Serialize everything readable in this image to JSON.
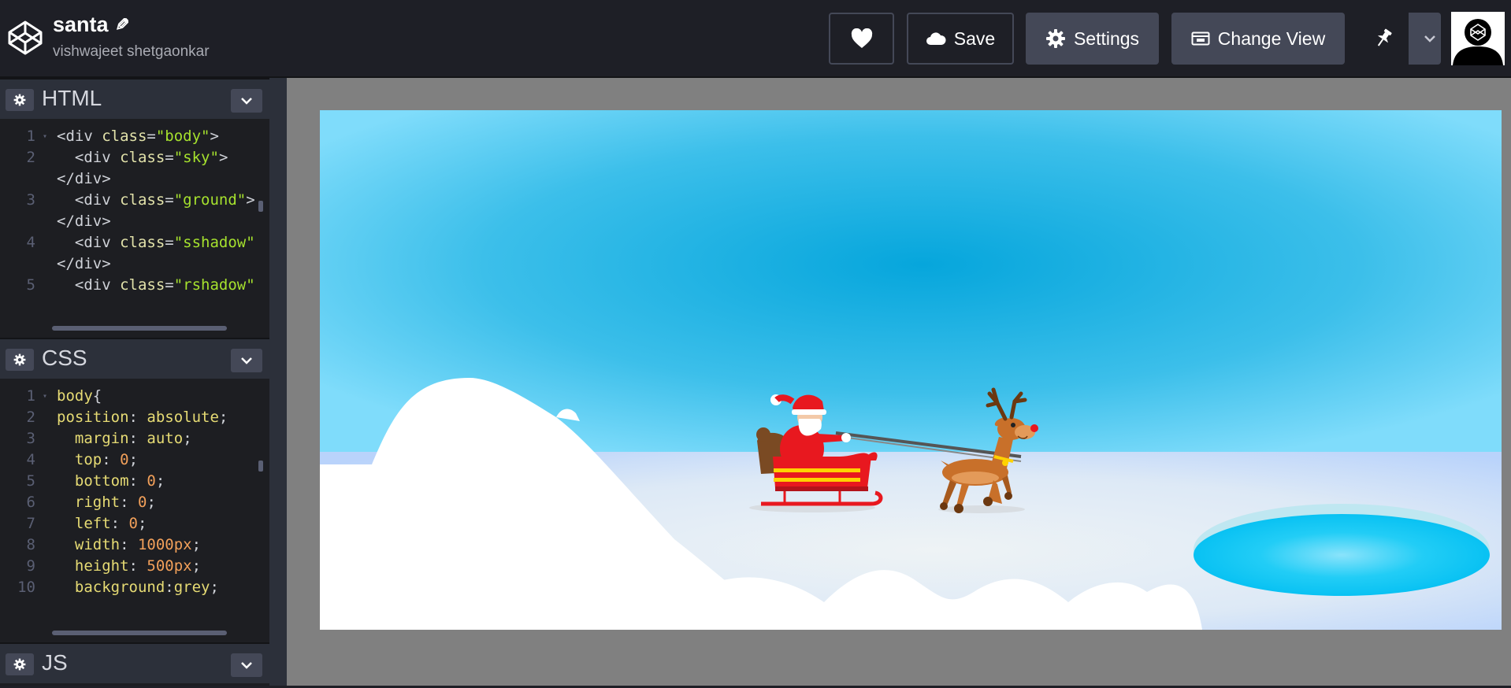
{
  "header": {
    "title": "santa",
    "author": "vishwajeet shetgaonkar",
    "buttons": {
      "save": "Save",
      "settings": "Settings",
      "change_view": "Change View"
    }
  },
  "editors": {
    "html": {
      "title": "HTML",
      "lines": [
        {
          "n": "1",
          "fold": true,
          "parts": [
            [
              "tag",
              "<div "
            ],
            [
              "attr",
              "class"
            ],
            [
              "tag",
              "="
            ],
            [
              "str",
              "\"body\""
            ],
            [
              "tag",
              ">"
            ]
          ]
        },
        {
          "n": "2",
          "parts": [
            [
              "tag",
              "  <div "
            ],
            [
              "attr",
              "class"
            ],
            [
              "tag",
              "="
            ],
            [
              "str",
              "\"sky\""
            ],
            [
              "tag",
              ">"
            ]
          ]
        },
        {
          "n": "",
          "parts": [
            [
              "tag",
              "</div>"
            ]
          ]
        },
        {
          "n": "3",
          "parts": [
            [
              "tag",
              "  <div "
            ],
            [
              "attr",
              "class"
            ],
            [
              "tag",
              "="
            ],
            [
              "str",
              "\"ground\""
            ],
            [
              "tag",
              ">"
            ]
          ]
        },
        {
          "n": "",
          "parts": [
            [
              "tag",
              "</div>"
            ]
          ]
        },
        {
          "n": "4",
          "parts": [
            [
              "tag",
              "  <div "
            ],
            [
              "attr",
              "class"
            ],
            [
              "tag",
              "="
            ],
            [
              "str",
              "\"sshadow\""
            ]
          ]
        },
        {
          "n": "",
          "parts": [
            [
              "tag",
              "</div>"
            ]
          ]
        },
        {
          "n": "5",
          "parts": [
            [
              "tag",
              "  <div "
            ],
            [
              "attr",
              "class"
            ],
            [
              "tag",
              "="
            ],
            [
              "str",
              "\"rshadow\""
            ]
          ]
        }
      ]
    },
    "css": {
      "title": "CSS",
      "lines": [
        {
          "n": "1",
          "fold": true,
          "parts": [
            [
              "sel",
              "body"
            ],
            [
              "tag",
              "{"
            ]
          ]
        },
        {
          "n": "2",
          "parts": [
            [
              "prop",
              "position"
            ],
            [
              "tag",
              ": "
            ],
            [
              "val",
              "absolute"
            ],
            [
              "tag",
              ";"
            ]
          ]
        },
        {
          "n": "3",
          "parts": [
            [
              "tag",
              "  "
            ],
            [
              "prop",
              "margin"
            ],
            [
              "tag",
              ": "
            ],
            [
              "val",
              "auto"
            ],
            [
              "tag",
              ";"
            ]
          ]
        },
        {
          "n": "4",
          "parts": [
            [
              "tag",
              "  "
            ],
            [
              "prop",
              "top"
            ],
            [
              "tag",
              ": "
            ],
            [
              "num",
              "0"
            ],
            [
              "tag",
              ";"
            ]
          ]
        },
        {
          "n": "5",
          "parts": [
            [
              "tag",
              "  "
            ],
            [
              "prop",
              "bottom"
            ],
            [
              "tag",
              ": "
            ],
            [
              "num",
              "0"
            ],
            [
              "tag",
              ";"
            ]
          ]
        },
        {
          "n": "6",
          "parts": [
            [
              "tag",
              "  "
            ],
            [
              "prop",
              "right"
            ],
            [
              "tag",
              ": "
            ],
            [
              "num",
              "0"
            ],
            [
              "tag",
              ";"
            ]
          ]
        },
        {
          "n": "7",
          "parts": [
            [
              "tag",
              "  "
            ],
            [
              "prop",
              "left"
            ],
            [
              "tag",
              ": "
            ],
            [
              "num",
              "0"
            ],
            [
              "tag",
              ";"
            ]
          ]
        },
        {
          "n": "8",
          "parts": [
            [
              "tag",
              "  "
            ],
            [
              "prop",
              "width"
            ],
            [
              "tag",
              ": "
            ],
            [
              "num",
              "1000px"
            ],
            [
              "tag",
              ";"
            ]
          ]
        },
        {
          "n": "9",
          "parts": [
            [
              "tag",
              "  "
            ],
            [
              "prop",
              "height"
            ],
            [
              "tag",
              ": "
            ],
            [
              "num",
              "500px"
            ],
            [
              "tag",
              ";"
            ]
          ]
        },
        {
          "n": "10",
          "parts": [
            [
              "tag",
              "  "
            ],
            [
              "prop",
              "background"
            ],
            [
              "tag",
              ":"
            ],
            [
              "val",
              "grey"
            ],
            [
              "tag",
              ";"
            ]
          ]
        }
      ]
    },
    "js": {
      "title": "JS"
    }
  },
  "colors": {
    "header_bg": "#1e1f26",
    "panel_bg": "#2c303a",
    "code_bg": "#1d1e22",
    "sky": "#0aa6dd",
    "santa_red": "#e8181f",
    "reindeer": "#c8702a"
  }
}
